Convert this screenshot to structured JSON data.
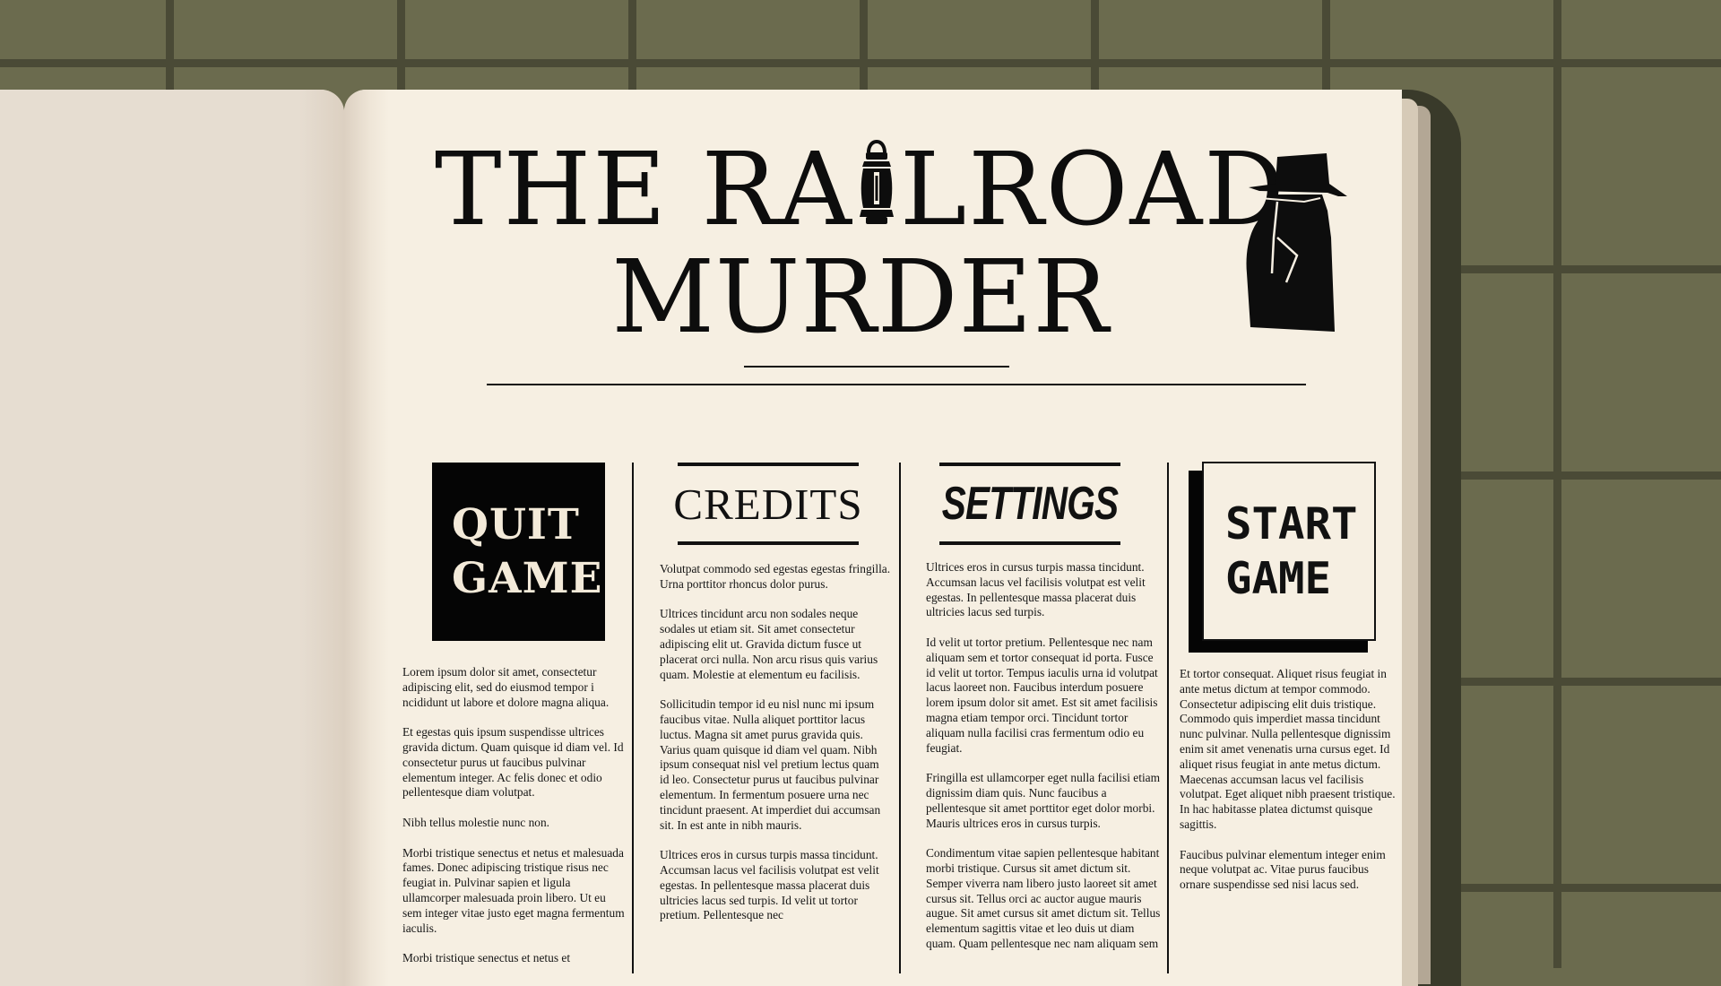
{
  "title": {
    "line1_part1": "THE RA",
    "line1_part2": "LROAD",
    "line2": "MURDER"
  },
  "icons": {
    "lantern": "lantern-icon",
    "detective": "detective-silhouette-icon"
  },
  "colors": {
    "background": "#6b6b4e",
    "grid_lines": "#4a4a36",
    "paper": "#f6efe2",
    "ink": "#0d0d0d"
  },
  "menu": {
    "quit": {
      "line1": "QUIT",
      "line2": "GAME"
    },
    "credits": "CREDITS",
    "settings": "SETTINGS",
    "start": {
      "line1": "START",
      "line2": "GAME"
    }
  },
  "columns": {
    "col1": [
      "Lorem ipsum dolor sit amet, consectetur adipiscing elit, sed do eiusmod tempor i ncididunt ut labore et dolore magna aliqua.",
      "Et egestas quis ipsum suspendisse ultrices gravida dictum. Quam quisque id diam vel. Id consectetur purus ut faucibus pulvinar elementum integer. Ac felis donec et odio pellentesque diam volutpat.",
      "Nibh tellus molestie nunc non.",
      "Morbi tristique senectus et netus et malesuada fames. Donec adipiscing tristique risus nec feugiat in. Pulvinar sapien et ligula ullamcorper malesuada proin libero. Ut eu sem integer vitae justo eget magna fermentum iaculis.",
      "Morbi tristique senectus et netus et"
    ],
    "col2": [
      "Volutpat commodo sed egestas egestas fringilla. Urna porttitor rhoncus dolor purus.",
      "Ultrices tincidunt arcu non sodales neque sodales ut etiam sit. Sit amet consectetur adipiscing elit ut. Gravida dictum fusce ut placerat orci nulla. Non arcu risus quis varius quam. Molestie at elementum eu facilisis.",
      "Sollicitudin tempor id eu nisl nunc mi ipsum faucibus vitae. Nulla aliquet porttitor lacus luctus. Magna sit amet purus gravida quis. Varius quam quisque id diam vel quam. Nibh ipsum consequat nisl vel pretium lectus quam id leo. Consectetur purus ut faucibus pulvinar elementum. In fermentum posuere urna nec tincidunt praesent. At imperdiet dui accumsan sit. In est ante in nibh mauris.",
      "Ultrices eros in cursus turpis massa tincidunt. Accumsan lacus vel facilisis volutpat est velit egestas. In pellentesque massa placerat duis ultricies lacus sed turpis. Id velit ut tortor pretium. Pellentesque nec"
    ],
    "col3": [
      "Ultrices eros in cursus turpis massa tincidunt. Accumsan lacus vel facilisis volutpat est velit egestas. In pellentesque massa placerat duis ultricies lacus sed turpis.",
      "Id velit ut tortor pretium. Pellentesque nec nam aliquam sem et tortor consequat id porta. Fusce id velit ut tortor. Tempus iaculis urna id volutpat lacus laoreet non. Faucibus interdum posuere lorem ipsum dolor sit amet. Est sit amet facilisis magna etiam tempor orci. Tincidunt tortor aliquam nulla facilisi cras fermentum odio eu feugiat.",
      "Fringilla est ullamcorper eget nulla facilisi etiam dignissim diam quis. Nunc faucibus a pellentesque sit amet porttitor eget dolor morbi. Mauris ultrices eros in cursus turpis.",
      "Condimentum vitae sapien pellentesque habitant morbi tristique. Cursus sit amet dictum sit. Semper viverra nam libero justo laoreet sit amet cursus sit. Tellus orci ac auctor augue mauris augue. Sit amet cursus sit amet dictum sit. Tellus elementum sagittis vitae et leo duis ut diam quam. Quam pellentesque nec nam aliquam sem"
    ],
    "col4": [
      "Et tortor consequat. Aliquet risus feugiat in ante metus dictum at tempor commodo. Consectetur adipiscing elit duis tristique. Commodo quis imperdiet massa tincidunt nunc pulvinar. Nulla pellentesque dignissim enim sit amet venenatis urna cursus eget. Id aliquet risus feugiat in ante metus dictum. Maecenas accumsan lacus vel facilisis volutpat. Eget aliquet nibh praesent tristique. In hac habitasse platea dictumst quisque sagittis.",
      "Faucibus pulvinar elementum integer enim neque volutpat ac. Vitae purus faucibus ornare suspendisse sed nisi lacus sed."
    ]
  }
}
